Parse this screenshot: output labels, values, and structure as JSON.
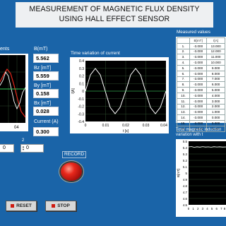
{
  "title": {
    "line1": "MEASUREMENT OF MAGNETIC FLUX DENSITY",
    "line2": "USING HALL EFFECT SENSOR"
  },
  "left_graph": {
    "label": "ents"
  },
  "indicators": [
    {
      "label": "B(mT)",
      "value": "5.562"
    },
    {
      "label": "Bz [mT]",
      "value": "5.559"
    },
    {
      "label": "By [mT]",
      "value": "0.158"
    },
    {
      "label": "Bx [mT]",
      "value": "0.028"
    },
    {
      "label": "Current (A)",
      "value": "0.300"
    }
  ],
  "time_graph": {
    "title": "Time variation of current",
    "ylabel": "I[A]",
    "xlabel": "t [s]",
    "yticks": [
      "0.4",
      "0.3",
      "0.2",
      "0.1",
      "0",
      "-0.1",
      "-0.2",
      "-0.3",
      "-0.4"
    ],
    "xticks": [
      "0",
      "0.01",
      "0.02",
      "0.03",
      "0.04"
    ]
  },
  "measured": {
    "title": "Measured values",
    "headers": [
      "B[mT]",
      "I[A]"
    ],
    "rows": [
      {
        "n": "1.",
        "b": "-3.000",
        "i": "13.000"
      },
      {
        "n": "2.",
        "b": "-3.000",
        "i": "12.000"
      },
      {
        "n": "3.",
        "b": "-3.000",
        "i": "11.000"
      },
      {
        "n": "4.",
        "b": "-3.000",
        "i": "10.000"
      },
      {
        "n": "5.",
        "b": "-3.000",
        "i": "9.000"
      },
      {
        "n": "6.",
        "b": "-3.000",
        "i": "8.000"
      },
      {
        "n": "7.",
        "b": "-3.000",
        "i": "7.000"
      },
      {
        "n": "8.",
        "b": "-3.000",
        "i": "6.000"
      },
      {
        "n": "9.",
        "b": "-3.000",
        "i": "5.000"
      },
      {
        "n": "10.",
        "b": "-3.000",
        "i": "4.000"
      },
      {
        "n": "11.",
        "b": "-3.000",
        "i": "3.000"
      },
      {
        "n": "12.",
        "b": "-3.000",
        "i": "2.000"
      },
      {
        "n": "13.",
        "b": "-3.000",
        "i": "1.000"
      },
      {
        "n": "14.",
        "b": "-3.000",
        "i": "0.000"
      },
      {
        "n": "15.",
        "b": "-3.000",
        "i": "0.000"
      },
      {
        "n": "16.",
        "b": "-3.000",
        "i": "0.000"
      }
    ]
  },
  "induction_graph": {
    "title_line1": "Total magnetic induction",
    "title_line2": "variation with t",
    "ylabel": "B[mT]",
    "yticks": [
      "5.5",
      "5.4",
      "5.3",
      "5.2",
      "5.1",
      "5",
      "4.9",
      "4.8",
      "4.7",
      "4.6",
      "4.5"
    ],
    "xticks": [
      "0",
      "1",
      "2",
      "3",
      "4",
      "5",
      "6",
      "7",
      "8"
    ]
  },
  "controls": {
    "step1_label": "2",
    "step1_value": "0",
    "step2_label": "2",
    "step2_value": "0",
    "record_label": "RECORD",
    "reset_label": "RESET",
    "stop_label": "STOP"
  },
  "colors": {
    "background": "#1a64a8",
    "plot_bg": "#000000",
    "trace_white": "#ffffff",
    "trace_green": "#35d05a",
    "trace_red": "#e8281c",
    "record_red": "#e8281c"
  }
}
